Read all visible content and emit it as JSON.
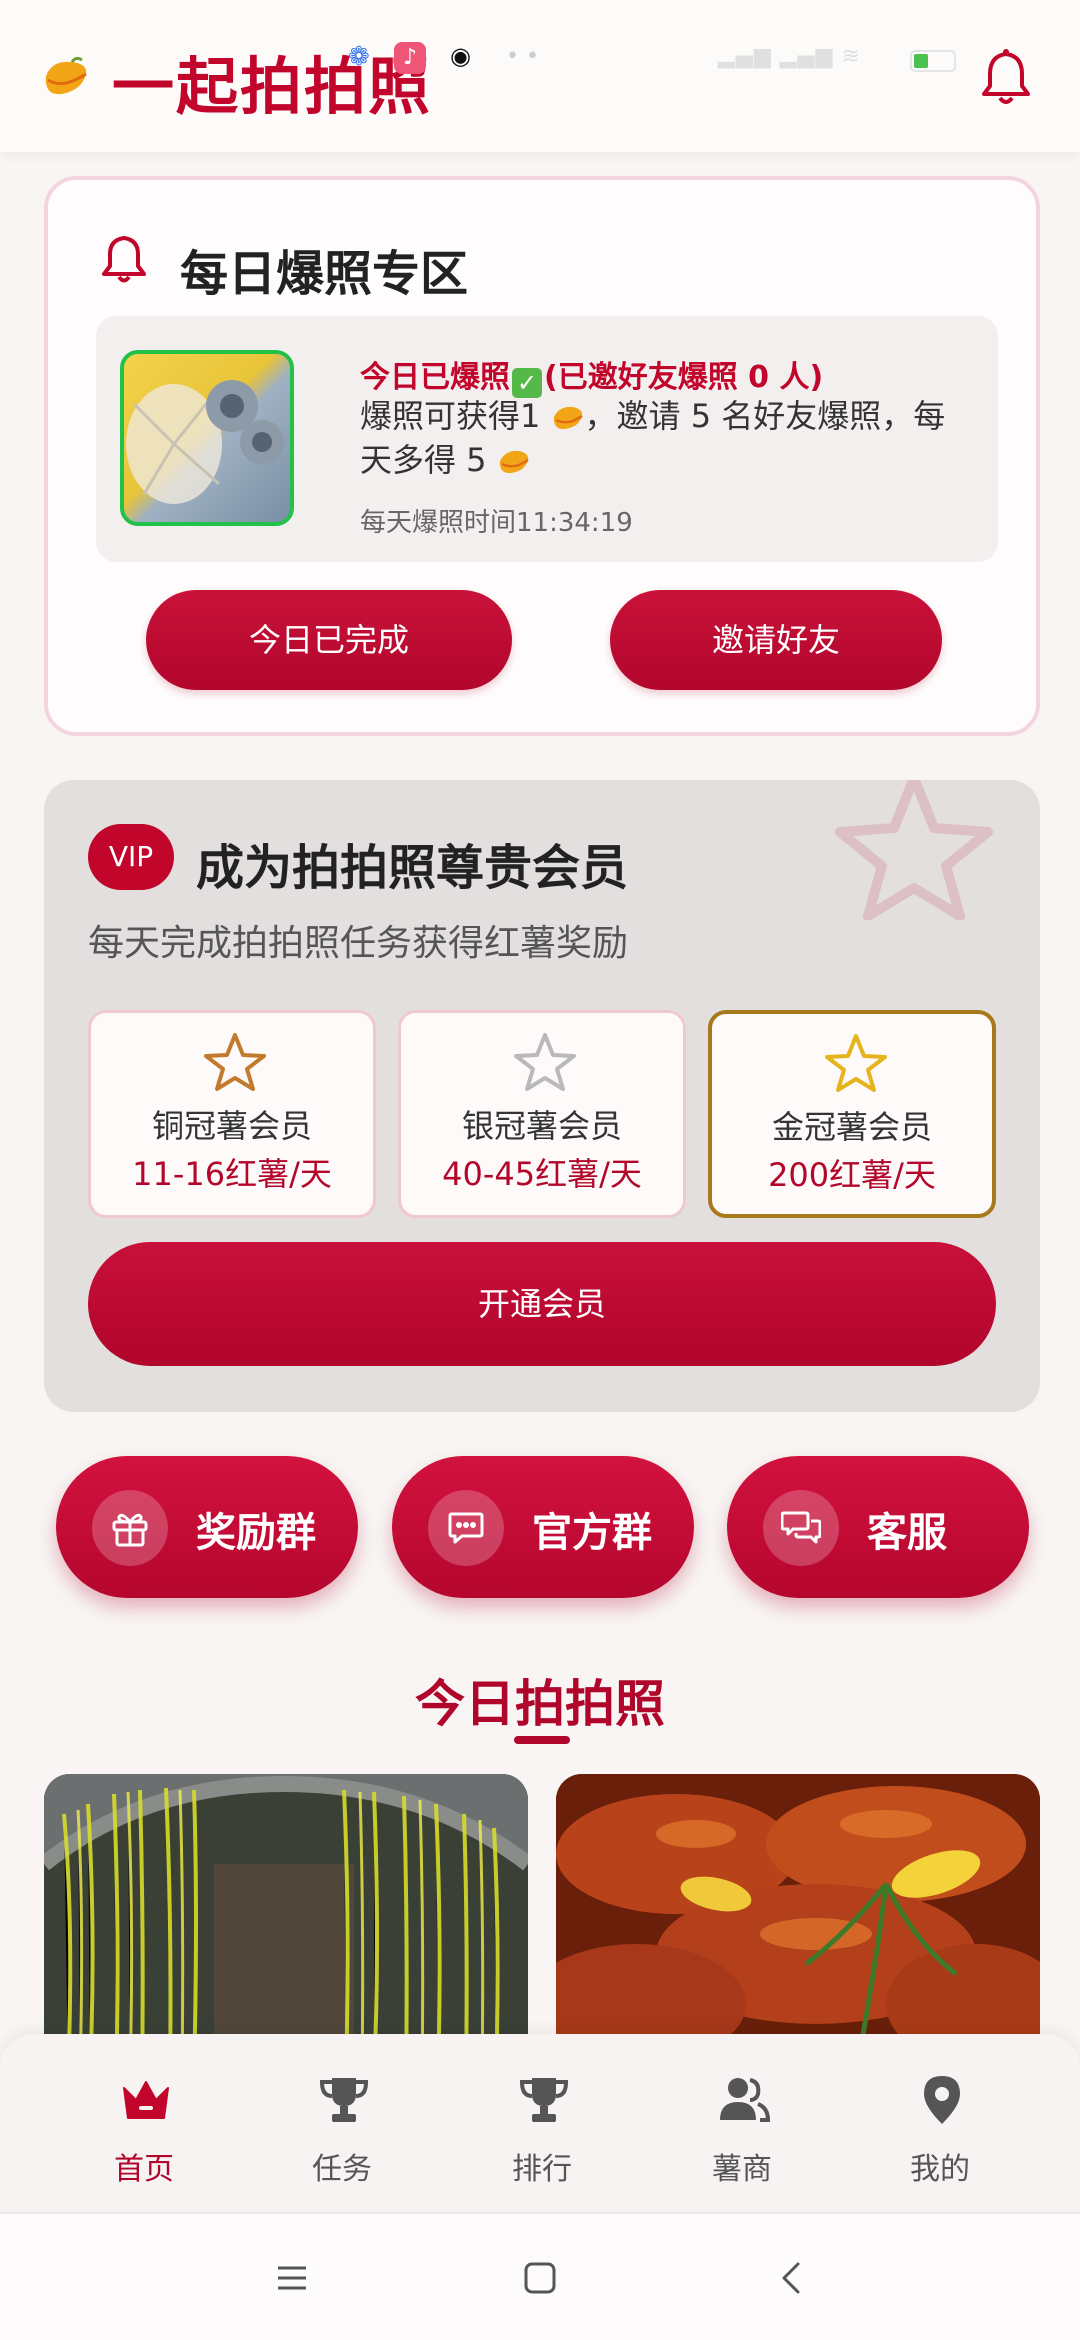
{
  "header": {
    "app_title": "一起拍拍照"
  },
  "status_bar": {
    "icons": [
      "baidu-icon",
      "tiktok-icon",
      "qq-icon",
      "more-dots-icon",
      "signal-icon",
      "wifi-icon",
      "battery-icon"
    ]
  },
  "daily": {
    "title": "每日爆照专区",
    "status_prefix": "今日已爆照",
    "status_suffix": "(已邀好友爆照 0 人)",
    "desc_part1": "爆照可获得1",
    "desc_part2": "，邀请 5 名好友爆照，每天多得 5",
    "time_text": "每天爆照时间11:34:19",
    "done_button": "今日已完成",
    "invite_button": "邀请好友"
  },
  "vip": {
    "badge": "VIP",
    "title": "成为拍拍照尊贵会员",
    "subtitle": "每天完成拍拍照任务获得红薯奖励",
    "tiers": [
      {
        "name": "铜冠薯会员",
        "reward": "11-16红薯/天",
        "star_color": "#c27b2e"
      },
      {
        "name": "银冠薯会员",
        "reward": "40-45红薯/天",
        "star_color": "#b9b9b9"
      },
      {
        "name": "金冠薯会员",
        "reward": "200红薯/天",
        "star_color": "#e6b51e"
      }
    ],
    "open_button": "开通会员"
  },
  "groups": [
    {
      "label": "奖励群",
      "icon": "gift-icon"
    },
    {
      "label": "官方群",
      "icon": "chat-icon"
    },
    {
      "label": "客服",
      "icon": "service-chat-icon"
    }
  ],
  "today": {
    "title": "今日拍拍照"
  },
  "nav": [
    {
      "label": "首页",
      "icon": "crown-icon",
      "active": true
    },
    {
      "label": "任务",
      "icon": "trophy-icon",
      "active": false
    },
    {
      "label": "排行",
      "icon": "trophy-icon",
      "active": false
    },
    {
      "label": "薯商",
      "icon": "users-icon",
      "active": false
    },
    {
      "label": "我的",
      "icon": "location-pin-icon",
      "active": false
    }
  ],
  "colors": {
    "primary": "#c1052b",
    "card_border": "#f3d6dd",
    "vip_bg": "#e2dfde"
  }
}
